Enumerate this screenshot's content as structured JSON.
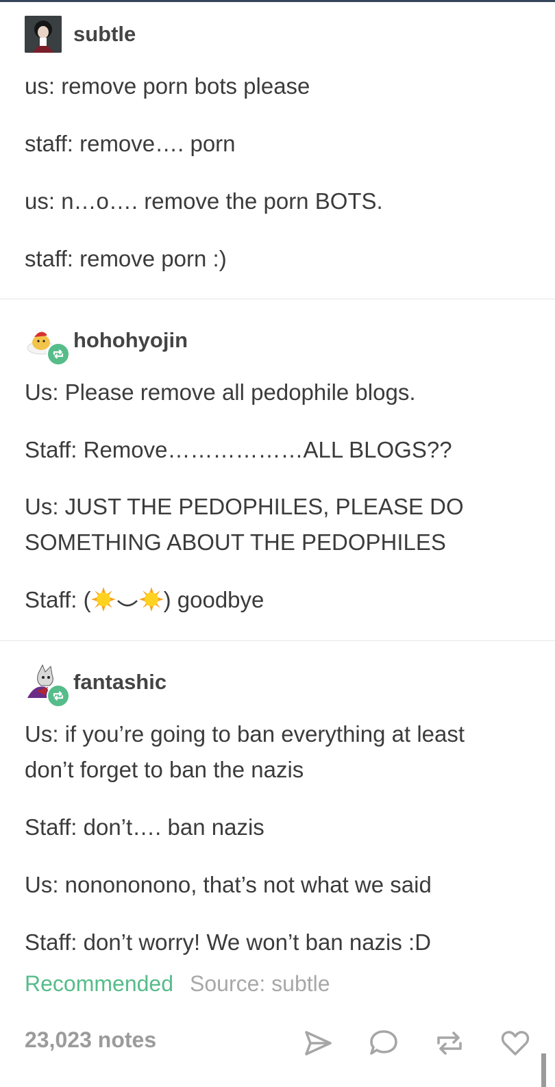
{
  "posts": [
    {
      "username": "subtle",
      "reblog": false,
      "lines": [
        "us: remove porn bots please",
        "staff: remove…. porn",
        "us: n…o…. remove the porn BOTS.",
        "staff: remove porn :)"
      ]
    },
    {
      "username": "hohohyojin",
      "reblog": true,
      "lines": [
        "Us: Please remove all pedophile blogs.",
        "Staff: Remove………………ALL BLOGS??",
        "Us: JUST THE PEDOPHILES, PLEASE DO",
        "SOMETHING ABOUT THE PEDOPHILES"
      ],
      "last_line_prefix": "Staff: (",
      "last_line_suffix": ") goodbye"
    },
    {
      "username": "fantashic",
      "reblog": true,
      "lines": [
        "Us: if you’re going to ban everything at least",
        "don’t forget to ban the nazis",
        "Staff: don’t…. ban nazis",
        "Us: nonononono, that’s not what we said",
        "Staff: don’t worry! We won’t ban nazis :D"
      ]
    }
  ],
  "footer": {
    "recommended": "Recommended",
    "source": "Source: subtle",
    "notes": "23,023 notes"
  },
  "icons": [
    "share-icon",
    "comment-icon",
    "reblog-icon",
    "like-icon"
  ],
  "colors": {
    "accent_green": "#56bc8a",
    "text": "#3b3b3b",
    "muted": "#9b9b9b"
  }
}
